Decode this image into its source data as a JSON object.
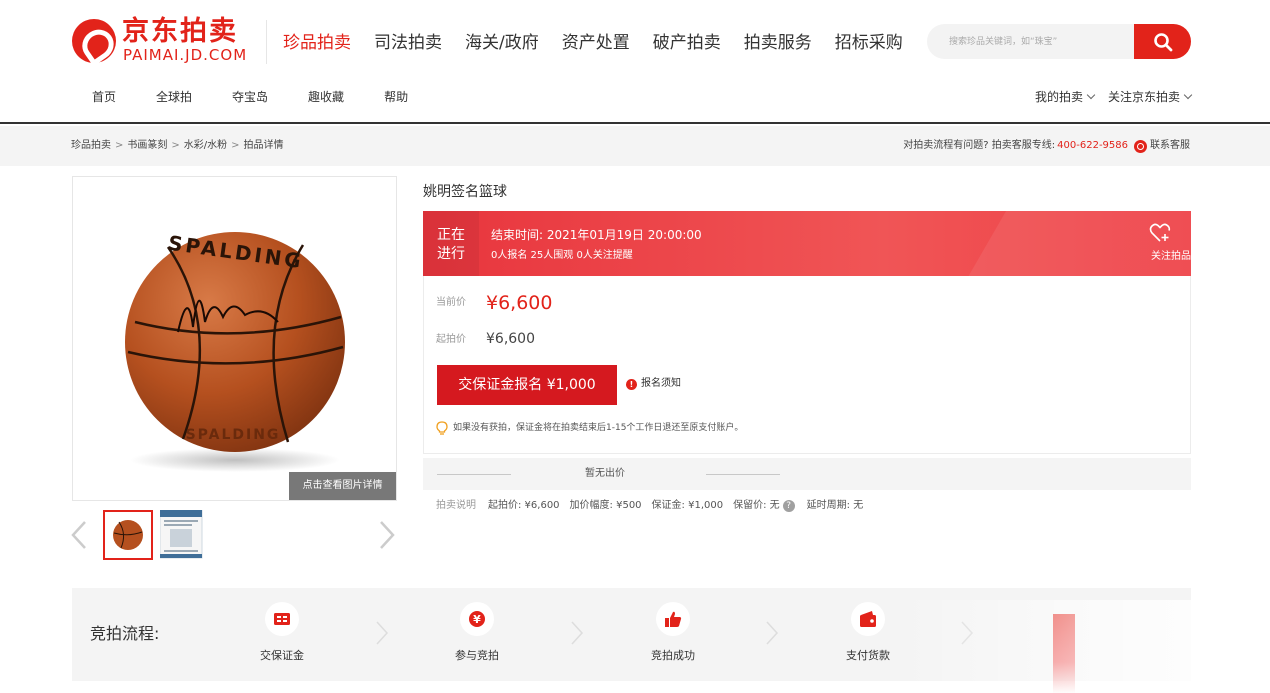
{
  "header": {
    "logo": {
      "cn": "京东拍卖",
      "en": "PAIMAI.JD.COM"
    },
    "nav": [
      {
        "label": "珍品拍卖",
        "active": true
      },
      {
        "label": "司法拍卖",
        "active": false
      },
      {
        "label": "海关/政府",
        "active": false
      },
      {
        "label": "资产处置",
        "active": false
      },
      {
        "label": "破产拍卖",
        "active": false
      },
      {
        "label": "拍卖服务",
        "active": false
      },
      {
        "label": "招标采购",
        "active": false
      }
    ],
    "search": {
      "placeholder": "搜索珍品关键词，如“珠宝”",
      "icon": "search-icon"
    }
  },
  "subnav": {
    "items": [
      "首页",
      "全球拍",
      "夺宝岛",
      "趣收藏",
      "帮助"
    ],
    "right": [
      "我的拍卖",
      "关注京东拍卖"
    ]
  },
  "breadcrumb": {
    "items": [
      "珍品拍卖",
      "书画篆刻",
      "水彩/水粉",
      "拍品详情"
    ],
    "separator": ">",
    "help_text": "对拍卖流程有问题? 拍卖客服专线:",
    "phone": "400-622-9586",
    "contact": "联系客服"
  },
  "gallery": {
    "view_detail": "点击查看图片详情",
    "thumbnails": [
      "basketball",
      "certificate"
    ],
    "selected_thumbnail": 0
  },
  "item": {
    "title": "姚明签名篮球",
    "status": {
      "line1": "正在",
      "line2": "进行"
    },
    "end_time": "结束时间: 2021年01月19日 20:00:00",
    "stats": "0人报名  25人围观  0人关注提醒",
    "follow": "关注拍品",
    "current_price_label": "当前价",
    "current_price": "¥6,600",
    "start_price_label": "起拍价",
    "start_price": "¥6,600",
    "deposit_button": "交保证金报名 ¥1,000",
    "notice": "报名须知",
    "refund_tip": "如果没有获拍，保证金将在拍卖结束后1-15个工作日退还至原支付账户。",
    "no_bid": "暂无出价",
    "auction_info": {
      "label": "拍卖说明",
      "start": "起拍价: ¥6,600",
      "increment": "加价幅度: ¥500",
      "deposit": "保证金: ¥1,000",
      "reserve": "保留价: 无",
      "extension": "延时周期: 无"
    }
  },
  "process": {
    "title": "竞拍流程:",
    "steps": [
      {
        "label": "交保证金",
        "icon": "deposit-icon"
      },
      {
        "label": "参与竞拍",
        "icon": "yen-icon"
      },
      {
        "label": "竞拍成功",
        "icon": "thumbs-up-icon"
      },
      {
        "label": "支付货款",
        "icon": "wallet-icon"
      }
    ]
  },
  "colors": {
    "brand": "#e2231a",
    "status_bar": "#ee4045"
  }
}
